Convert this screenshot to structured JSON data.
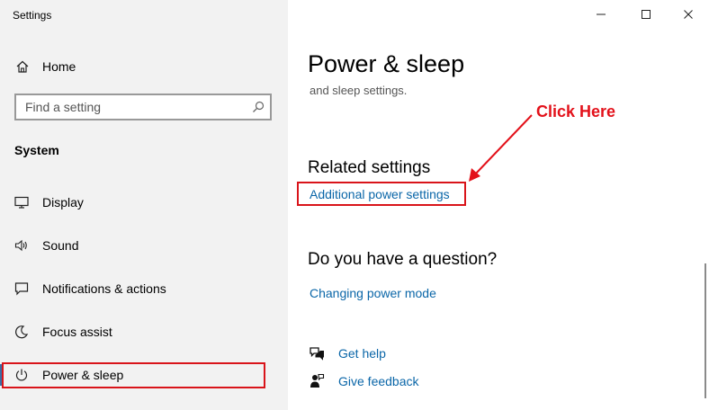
{
  "window": {
    "title": "Settings",
    "minimize_icon": "minimize-icon",
    "maximize_icon": "maximize-icon",
    "close_icon": "close-icon"
  },
  "sidebar": {
    "home": {
      "label": "Home",
      "icon": "home-icon"
    },
    "search": {
      "placeholder": "Find a setting",
      "value": "",
      "icon": "search-icon"
    },
    "section_title": "System",
    "items": [
      {
        "label": "Display",
        "icon": "display-icon",
        "selected": false
      },
      {
        "label": "Sound",
        "icon": "speaker-icon",
        "selected": false
      },
      {
        "label": "Notifications & actions",
        "icon": "notifications-icon",
        "selected": false
      },
      {
        "label": "Focus assist",
        "icon": "moon-icon",
        "selected": false
      },
      {
        "label": "Power & sleep",
        "icon": "power-icon",
        "selected": true
      }
    ]
  },
  "main": {
    "title": "Power & sleep",
    "partial_text": "and sleep settings.",
    "related_heading": "Related settings",
    "additional_power_link": "Additional power settings",
    "question_heading": "Do you have a question?",
    "changing_power_link": "Changing power mode",
    "get_help_link": "Get help",
    "give_feedback_link": "Give feedback"
  },
  "annotation": {
    "text": "Click Here",
    "color": "#e3111a"
  },
  "colors": {
    "sidebar_bg": "#f2f2f2",
    "link": "#0a66a8",
    "highlight_border": "#d9141a",
    "accent": "#3a6ea5"
  }
}
